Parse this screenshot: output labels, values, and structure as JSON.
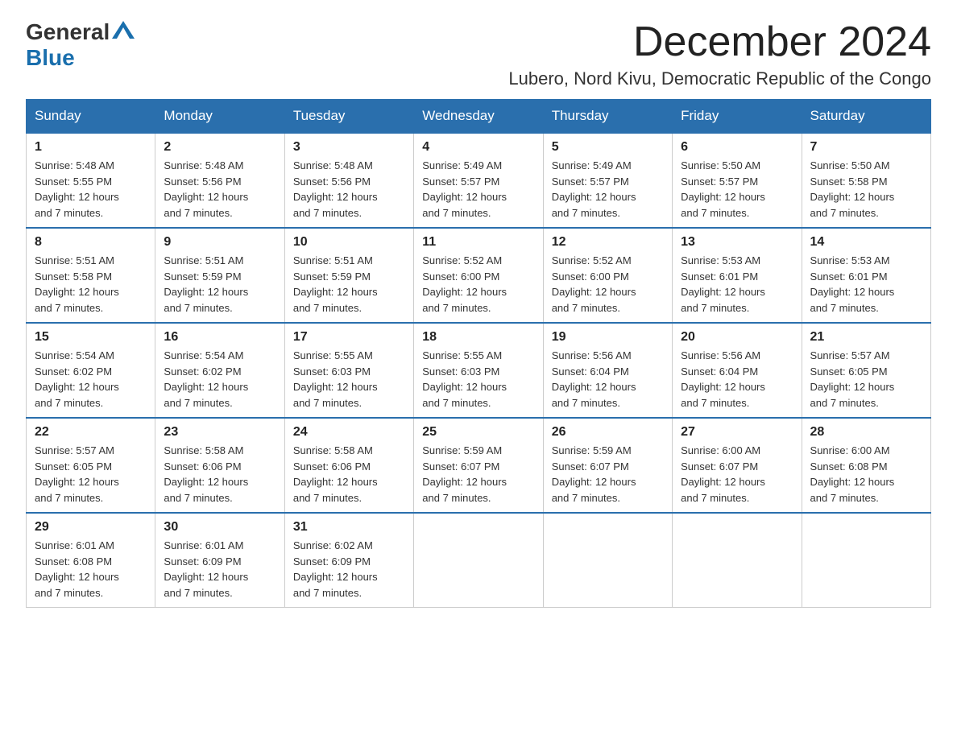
{
  "header": {
    "logo_general": "General",
    "logo_blue": "Blue",
    "title": "December 2024",
    "subtitle": "Lubero, Nord Kivu, Democratic Republic of the Congo"
  },
  "weekdays": [
    "Sunday",
    "Monday",
    "Tuesday",
    "Wednesday",
    "Thursday",
    "Friday",
    "Saturday"
  ],
  "weeks": [
    [
      {
        "day": "1",
        "sunrise": "5:48 AM",
        "sunset": "5:55 PM",
        "daylight": "12 hours and 7 minutes."
      },
      {
        "day": "2",
        "sunrise": "5:48 AM",
        "sunset": "5:56 PM",
        "daylight": "12 hours and 7 minutes."
      },
      {
        "day": "3",
        "sunrise": "5:48 AM",
        "sunset": "5:56 PM",
        "daylight": "12 hours and 7 minutes."
      },
      {
        "day": "4",
        "sunrise": "5:49 AM",
        "sunset": "5:57 PM",
        "daylight": "12 hours and 7 minutes."
      },
      {
        "day": "5",
        "sunrise": "5:49 AM",
        "sunset": "5:57 PM",
        "daylight": "12 hours and 7 minutes."
      },
      {
        "day": "6",
        "sunrise": "5:50 AM",
        "sunset": "5:57 PM",
        "daylight": "12 hours and 7 minutes."
      },
      {
        "day": "7",
        "sunrise": "5:50 AM",
        "sunset": "5:58 PM",
        "daylight": "12 hours and 7 minutes."
      }
    ],
    [
      {
        "day": "8",
        "sunrise": "5:51 AM",
        "sunset": "5:58 PM",
        "daylight": "12 hours and 7 minutes."
      },
      {
        "day": "9",
        "sunrise": "5:51 AM",
        "sunset": "5:59 PM",
        "daylight": "12 hours and 7 minutes."
      },
      {
        "day": "10",
        "sunrise": "5:51 AM",
        "sunset": "5:59 PM",
        "daylight": "12 hours and 7 minutes."
      },
      {
        "day": "11",
        "sunrise": "5:52 AM",
        "sunset": "6:00 PM",
        "daylight": "12 hours and 7 minutes."
      },
      {
        "day": "12",
        "sunrise": "5:52 AM",
        "sunset": "6:00 PM",
        "daylight": "12 hours and 7 minutes."
      },
      {
        "day": "13",
        "sunrise": "5:53 AM",
        "sunset": "6:01 PM",
        "daylight": "12 hours and 7 minutes."
      },
      {
        "day": "14",
        "sunrise": "5:53 AM",
        "sunset": "6:01 PM",
        "daylight": "12 hours and 7 minutes."
      }
    ],
    [
      {
        "day": "15",
        "sunrise": "5:54 AM",
        "sunset": "6:02 PM",
        "daylight": "12 hours and 7 minutes."
      },
      {
        "day": "16",
        "sunrise": "5:54 AM",
        "sunset": "6:02 PM",
        "daylight": "12 hours and 7 minutes."
      },
      {
        "day": "17",
        "sunrise": "5:55 AM",
        "sunset": "6:03 PM",
        "daylight": "12 hours and 7 minutes."
      },
      {
        "day": "18",
        "sunrise": "5:55 AM",
        "sunset": "6:03 PM",
        "daylight": "12 hours and 7 minutes."
      },
      {
        "day": "19",
        "sunrise": "5:56 AM",
        "sunset": "6:04 PM",
        "daylight": "12 hours and 7 minutes."
      },
      {
        "day": "20",
        "sunrise": "5:56 AM",
        "sunset": "6:04 PM",
        "daylight": "12 hours and 7 minutes."
      },
      {
        "day": "21",
        "sunrise": "5:57 AM",
        "sunset": "6:05 PM",
        "daylight": "12 hours and 7 minutes."
      }
    ],
    [
      {
        "day": "22",
        "sunrise": "5:57 AM",
        "sunset": "6:05 PM",
        "daylight": "12 hours and 7 minutes."
      },
      {
        "day": "23",
        "sunrise": "5:58 AM",
        "sunset": "6:06 PM",
        "daylight": "12 hours and 7 minutes."
      },
      {
        "day": "24",
        "sunrise": "5:58 AM",
        "sunset": "6:06 PM",
        "daylight": "12 hours and 7 minutes."
      },
      {
        "day": "25",
        "sunrise": "5:59 AM",
        "sunset": "6:07 PM",
        "daylight": "12 hours and 7 minutes."
      },
      {
        "day": "26",
        "sunrise": "5:59 AM",
        "sunset": "6:07 PM",
        "daylight": "12 hours and 7 minutes."
      },
      {
        "day": "27",
        "sunrise": "6:00 AM",
        "sunset": "6:07 PM",
        "daylight": "12 hours and 7 minutes."
      },
      {
        "day": "28",
        "sunrise": "6:00 AM",
        "sunset": "6:08 PM",
        "daylight": "12 hours and 7 minutes."
      }
    ],
    [
      {
        "day": "29",
        "sunrise": "6:01 AM",
        "sunset": "6:08 PM",
        "daylight": "12 hours and 7 minutes."
      },
      {
        "day": "30",
        "sunrise": "6:01 AM",
        "sunset": "6:09 PM",
        "daylight": "12 hours and 7 minutes."
      },
      {
        "day": "31",
        "sunrise": "6:02 AM",
        "sunset": "6:09 PM",
        "daylight": "12 hours and 7 minutes."
      },
      null,
      null,
      null,
      null
    ]
  ]
}
